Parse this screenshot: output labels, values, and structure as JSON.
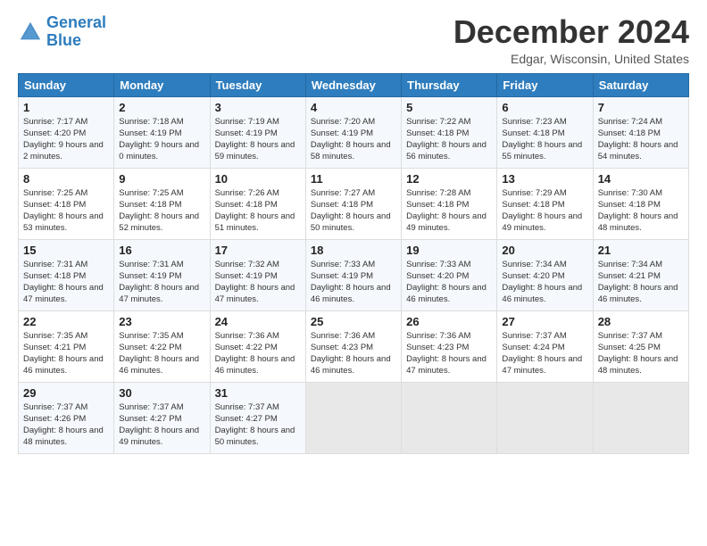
{
  "logo": {
    "line1": "General",
    "line2": "Blue"
  },
  "title": "December 2024",
  "location": "Edgar, Wisconsin, United States",
  "days_header": [
    "Sunday",
    "Monday",
    "Tuesday",
    "Wednesday",
    "Thursday",
    "Friday",
    "Saturday"
  ],
  "weeks": [
    [
      {
        "day": "1",
        "sunrise": "7:17 AM",
        "sunset": "4:20 PM",
        "daylight": "9 hours and 2 minutes."
      },
      {
        "day": "2",
        "sunrise": "7:18 AM",
        "sunset": "4:19 PM",
        "daylight": "9 hours and 0 minutes."
      },
      {
        "day": "3",
        "sunrise": "7:19 AM",
        "sunset": "4:19 PM",
        "daylight": "8 hours and 59 minutes."
      },
      {
        "day": "4",
        "sunrise": "7:20 AM",
        "sunset": "4:19 PM",
        "daylight": "8 hours and 58 minutes."
      },
      {
        "day": "5",
        "sunrise": "7:22 AM",
        "sunset": "4:18 PM",
        "daylight": "8 hours and 56 minutes."
      },
      {
        "day": "6",
        "sunrise": "7:23 AM",
        "sunset": "4:18 PM",
        "daylight": "8 hours and 55 minutes."
      },
      {
        "day": "7",
        "sunrise": "7:24 AM",
        "sunset": "4:18 PM",
        "daylight": "8 hours and 54 minutes."
      }
    ],
    [
      {
        "day": "8",
        "sunrise": "7:25 AM",
        "sunset": "4:18 PM",
        "daylight": "8 hours and 53 minutes."
      },
      {
        "day": "9",
        "sunrise": "7:25 AM",
        "sunset": "4:18 PM",
        "daylight": "8 hours and 52 minutes."
      },
      {
        "day": "10",
        "sunrise": "7:26 AM",
        "sunset": "4:18 PM",
        "daylight": "8 hours and 51 minutes."
      },
      {
        "day": "11",
        "sunrise": "7:27 AM",
        "sunset": "4:18 PM",
        "daylight": "8 hours and 50 minutes."
      },
      {
        "day": "12",
        "sunrise": "7:28 AM",
        "sunset": "4:18 PM",
        "daylight": "8 hours and 49 minutes."
      },
      {
        "day": "13",
        "sunrise": "7:29 AM",
        "sunset": "4:18 PM",
        "daylight": "8 hours and 49 minutes."
      },
      {
        "day": "14",
        "sunrise": "7:30 AM",
        "sunset": "4:18 PM",
        "daylight": "8 hours and 48 minutes."
      }
    ],
    [
      {
        "day": "15",
        "sunrise": "7:31 AM",
        "sunset": "4:18 PM",
        "daylight": "8 hours and 47 minutes."
      },
      {
        "day": "16",
        "sunrise": "7:31 AM",
        "sunset": "4:19 PM",
        "daylight": "8 hours and 47 minutes."
      },
      {
        "day": "17",
        "sunrise": "7:32 AM",
        "sunset": "4:19 PM",
        "daylight": "8 hours and 47 minutes."
      },
      {
        "day": "18",
        "sunrise": "7:33 AM",
        "sunset": "4:19 PM",
        "daylight": "8 hours and 46 minutes."
      },
      {
        "day": "19",
        "sunrise": "7:33 AM",
        "sunset": "4:20 PM",
        "daylight": "8 hours and 46 minutes."
      },
      {
        "day": "20",
        "sunrise": "7:34 AM",
        "sunset": "4:20 PM",
        "daylight": "8 hours and 46 minutes."
      },
      {
        "day": "21",
        "sunrise": "7:34 AM",
        "sunset": "4:21 PM",
        "daylight": "8 hours and 46 minutes."
      }
    ],
    [
      {
        "day": "22",
        "sunrise": "7:35 AM",
        "sunset": "4:21 PM",
        "daylight": "8 hours and 46 minutes."
      },
      {
        "day": "23",
        "sunrise": "7:35 AM",
        "sunset": "4:22 PM",
        "daylight": "8 hours and 46 minutes."
      },
      {
        "day": "24",
        "sunrise": "7:36 AM",
        "sunset": "4:22 PM",
        "daylight": "8 hours and 46 minutes."
      },
      {
        "day": "25",
        "sunrise": "7:36 AM",
        "sunset": "4:23 PM",
        "daylight": "8 hours and 46 minutes."
      },
      {
        "day": "26",
        "sunrise": "7:36 AM",
        "sunset": "4:23 PM",
        "daylight": "8 hours and 47 minutes."
      },
      {
        "day": "27",
        "sunrise": "7:37 AM",
        "sunset": "4:24 PM",
        "daylight": "8 hours and 47 minutes."
      },
      {
        "day": "28",
        "sunrise": "7:37 AM",
        "sunset": "4:25 PM",
        "daylight": "8 hours and 48 minutes."
      }
    ],
    [
      {
        "day": "29",
        "sunrise": "7:37 AM",
        "sunset": "4:26 PM",
        "daylight": "8 hours and 48 minutes."
      },
      {
        "day": "30",
        "sunrise": "7:37 AM",
        "sunset": "4:27 PM",
        "daylight": "8 hours and 49 minutes."
      },
      {
        "day": "31",
        "sunrise": "7:37 AM",
        "sunset": "4:27 PM",
        "daylight": "8 hours and 50 minutes."
      },
      null,
      null,
      null,
      null
    ]
  ]
}
